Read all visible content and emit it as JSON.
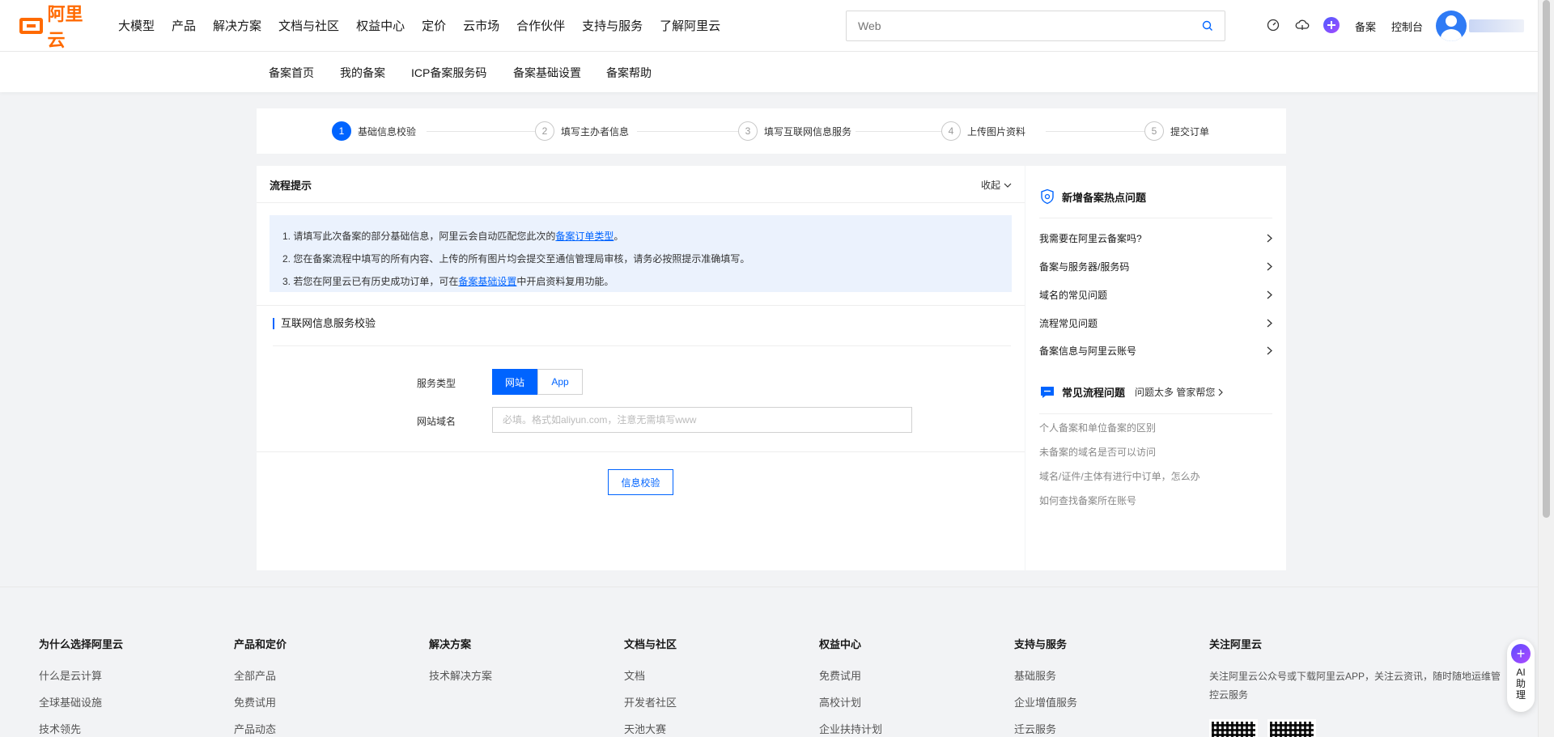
{
  "header": {
    "logo_text": "阿里云",
    "nav": [
      "大模型",
      "产品",
      "解决方案",
      "文档与社区",
      "权益中心",
      "定价",
      "云市场",
      "合作伙伴",
      "支持与服务",
      "了解阿里云"
    ],
    "search_placeholder": "Web",
    "beian_link": "备案",
    "console_link": "控制台"
  },
  "subnav": [
    "备案首页",
    "我的备案",
    "ICP备案服务码",
    "备案基础设置",
    "备案帮助"
  ],
  "steps": [
    {
      "num": "1",
      "label": "基础信息校验",
      "active": true
    },
    {
      "num": "2",
      "label": "填写主办者信息",
      "active": false
    },
    {
      "num": "3",
      "label": "填写互联网信息服务",
      "active": false
    },
    {
      "num": "4",
      "label": "上传图片资料",
      "active": false
    },
    {
      "num": "5",
      "label": "提交订单",
      "active": false
    }
  ],
  "flow": {
    "title": "流程提示",
    "collapse": "收起",
    "tip1_pre": "1. 请填写此次备案的部分基础信息，阿里云会自动匹配您此次的",
    "tip1_link": "备案订单类型",
    "tip1_post": "。",
    "tip2": "2. 您在备案流程中填写的所有内容、上传的所有图片均会提交至通信管理局审核，请务必按照提示准确填写。",
    "tip3_pre": "3. 若您在阿里云已有历史成功订单，可在",
    "tip3_link": "备案基础设置",
    "tip3_post": "中开启资料复用功能。"
  },
  "form": {
    "section_title": "互联网信息服务校验",
    "service_type_label": "服务类型",
    "opt_website": "网站",
    "opt_app": "App",
    "domain_label": "网站域名",
    "domain_placeholder": "必填。格式如aliyun.com，注意无需填写www",
    "verify_button": "信息校验"
  },
  "side": {
    "hot_title": "新增备案热点问题",
    "hot_items": [
      "我需要在阿里云备案吗?",
      "备案与服务器/服务码",
      "域名的常见问题",
      "流程常见问题",
      "备案信息与阿里云账号"
    ],
    "common_title": "常见流程问题",
    "common_sub": "问题太多 管家帮您",
    "common_items": [
      "个人备案和单位备案的区别",
      "未备案的域名是否可以访问",
      "域名/证件/主体有进行中订单，怎么办",
      "如何查找备案所在账号"
    ]
  },
  "footer": {
    "cols": [
      {
        "title": "为什么选择阿里云",
        "items": [
          "什么是云计算",
          "全球基础设施",
          "技术领先"
        ]
      },
      {
        "title": "产品和定价",
        "items": [
          "全部产品",
          "免费试用",
          "产品动态"
        ]
      },
      {
        "title": "解决方案",
        "items": [
          "技术解决方案"
        ]
      },
      {
        "title": "文档与社区",
        "items": [
          "文档",
          "开发者社区",
          "天池大赛"
        ]
      },
      {
        "title": "权益中心",
        "items": [
          "免费试用",
          "高校计划",
          "企业扶持计划"
        ]
      },
      {
        "title": "支持与服务",
        "items": [
          "基础服务",
          "企业增值服务",
          "迁云服务"
        ]
      }
    ],
    "follow_title": "关注阿里云",
    "follow_text": "关注阿里云公众号或下载阿里云APP，关注云资讯，随时随地运维管控云服务"
  },
  "ai_helper": {
    "label": "AI助理"
  },
  "colors": {
    "primary": "#0064ff",
    "brand": "#ff6a00",
    "tips_bg": "#ebf2fd"
  }
}
